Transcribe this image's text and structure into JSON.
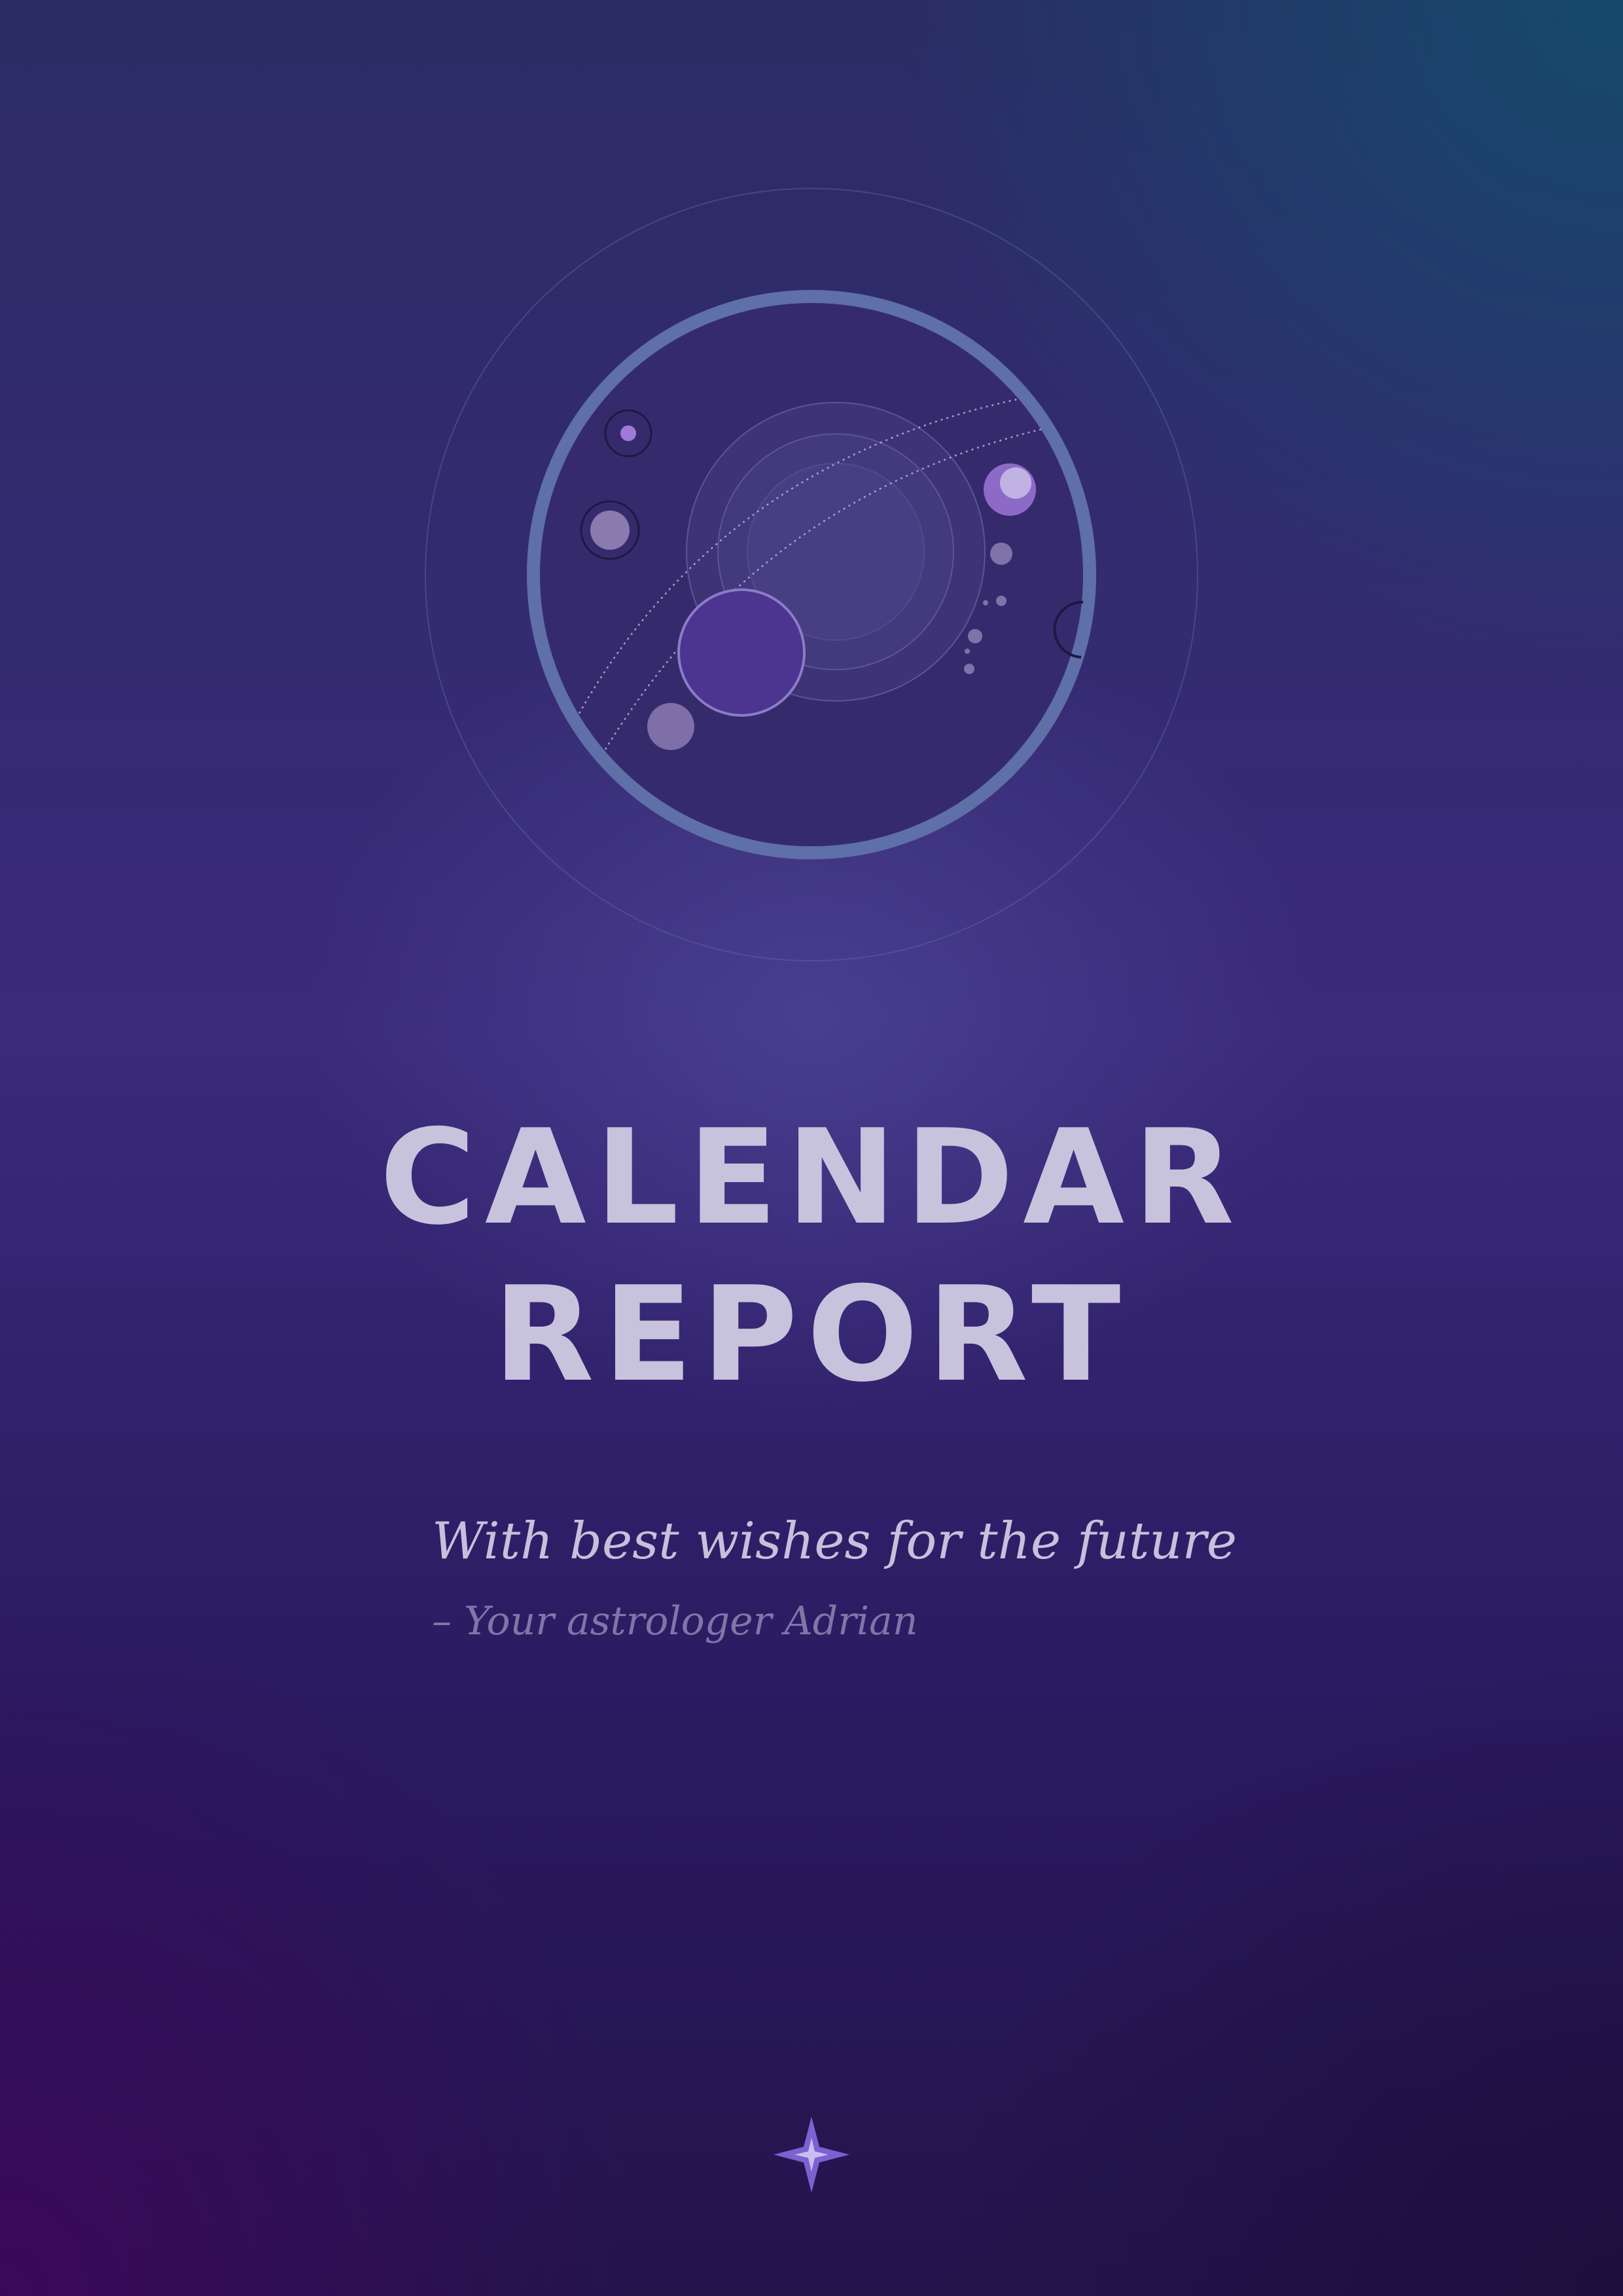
{
  "cover": {
    "title_line1": "CALENDAR",
    "title_line2": "REPORT",
    "wishes": "With best wishes for the future",
    "signature": "– Your astrologer Adrian"
  },
  "icons": {
    "emblem": "planetary-system-emblem-icon",
    "star": "four-point-star-icon"
  },
  "colors": {
    "title_text": "#c8c3dd",
    "signature_text": "#7f76a8",
    "star_fill": "#7a62d0",
    "emblem_ring": "#5f6fa8",
    "emblem_disc": "#352b6c"
  }
}
